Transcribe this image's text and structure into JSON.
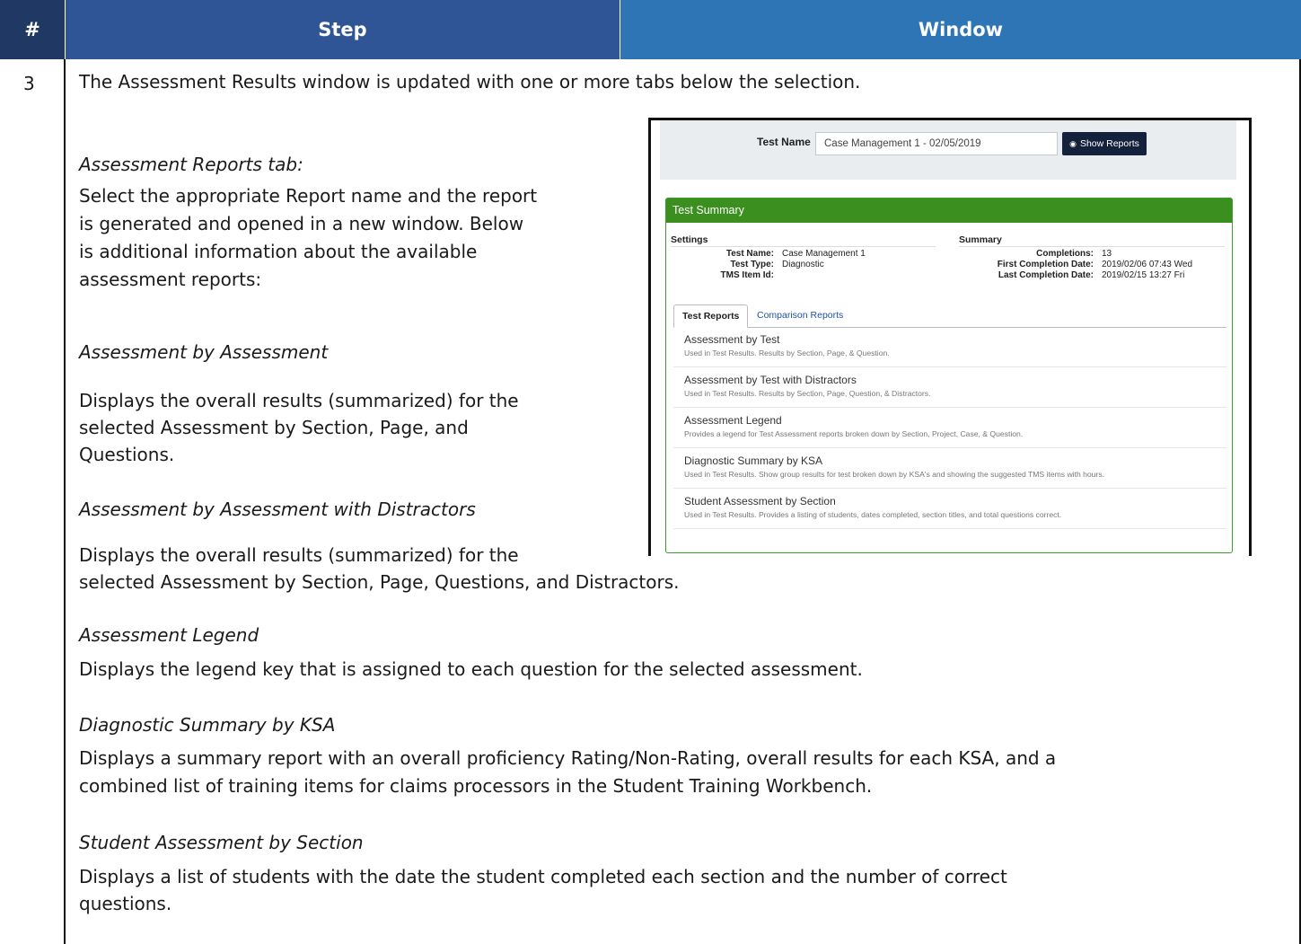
{
  "table": {
    "headers": {
      "num": "#",
      "step": "Step",
      "window": "Window"
    },
    "row_number": "3",
    "intro": "The Assessment Results window is updated with one or more tabs below the selection.",
    "reports_tab_heading": "Assessment Reports tab:",
    "reports_tab_body": [
      "Select the appropriate Report name and the report",
      "is generated and opened in a new window. Below",
      "is additional information about the available",
      "assessment reports:"
    ],
    "sections": [
      {
        "title": "Assessment by Assessment",
        "body": [
          "Displays the overall results (summarized) for the",
          "selected Assessment by Section, Page, and",
          "Questions."
        ]
      },
      {
        "title": "Assessment by Assessment with Distractors",
        "body": [
          "Displays the overall results (summarized) for the",
          "selected Assessment by Section, Page, Questions, and Distractors."
        ]
      },
      {
        "title": "Assessment Legend",
        "body": [
          "Displays the legend key that is assigned to each question for the selected assessment."
        ]
      },
      {
        "title": "Diagnostic Summary by KSA",
        "body": [
          "Displays a summary report with an overall proficiency Rating/Non-Rating, overall results for each KSA, and a",
          "combined list of training items for claims processors in the Student Training Workbench."
        ]
      },
      {
        "title": "Student Assessment by Section",
        "body": [
          "Displays a list of students with the date the student completed each section and the number of correct",
          "questions."
        ]
      }
    ]
  },
  "screenshot": {
    "test_name_label": "Test Name",
    "test_name_value": "Case Management 1 - 02/05/2019",
    "show_reports_label": "Show Reports",
    "panel_title": "Test Summary",
    "settings_heading": "Settings",
    "summary_heading": "Summary",
    "settings": [
      {
        "key": "Test Name:",
        "value": "Case Management 1"
      },
      {
        "key": "Test Type:",
        "value": "Diagnostic"
      },
      {
        "key": "TMS Item Id:",
        "value": ""
      }
    ],
    "summary": [
      {
        "key": "Completions:",
        "value": "13"
      },
      {
        "key": "First Completion Date:",
        "value": "2019/02/06 07:43 Wed"
      },
      {
        "key": "Last Completion Date:",
        "value": "2019/02/15 13:27 Fri"
      }
    ],
    "tabs": [
      {
        "label": "Test Reports",
        "active": true
      },
      {
        "label": "Comparison Reports",
        "active": false
      }
    ],
    "reports": [
      {
        "name": "Assessment by Test",
        "desc": "Used in Test Results. Results by Section, Page, & Question."
      },
      {
        "name": "Assessment by Test with Distractors",
        "desc": "Used in Test Results. Results by Section, Page, Question, & Distractors."
      },
      {
        "name": "Assessment Legend",
        "desc": "Provides a legend for Test Assessment reports broken down by Section, Project, Case, & Question."
      },
      {
        "name": "Diagnostic Summary by KSA",
        "desc": "Used in Test Results. Show group results for test broken down by KSA's and showing the suggested TMS items with hours."
      },
      {
        "name": "Student Assessment by Section",
        "desc": "Used in Test Results. Provides a listing of students, dates completed, section titles, and total questions correct."
      }
    ]
  }
}
